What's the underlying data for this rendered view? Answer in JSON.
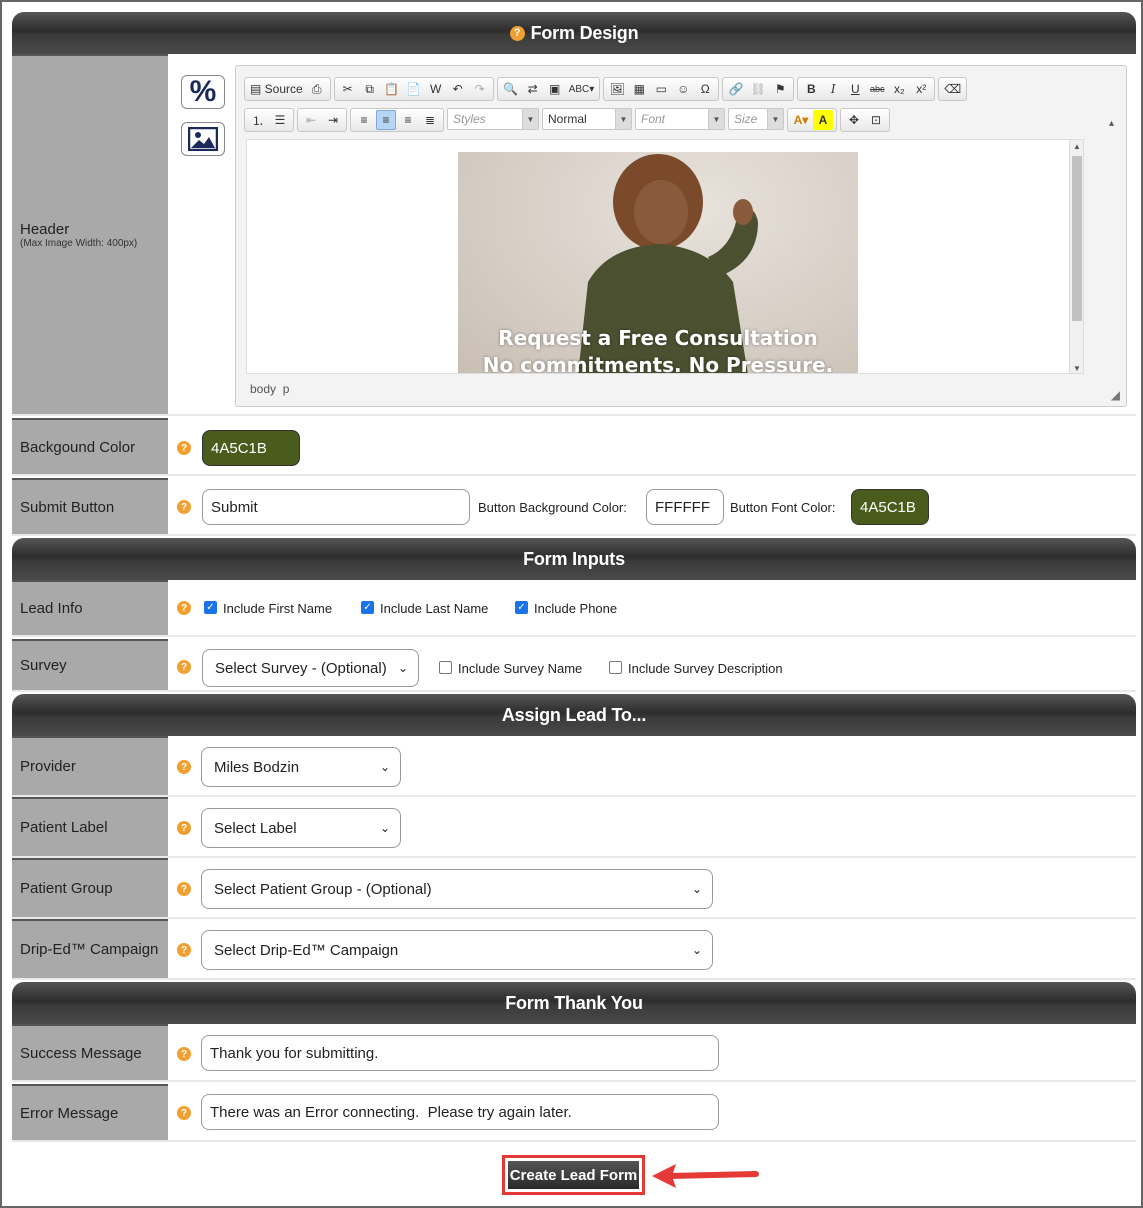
{
  "sections": {
    "form_design": "Form Design",
    "form_inputs": "Form Inputs",
    "assign_lead": "Assign Lead To...",
    "form_thank_you": "Form Thank You"
  },
  "header_row": {
    "label": "Header",
    "sublabel": "(Max Image Width: 400px)",
    "side_buttons": [
      "percent-icon",
      "image-icon"
    ]
  },
  "editor": {
    "source_label": "Source",
    "styles_placeholder": "Styles",
    "format_value": "Normal",
    "font_placeholder": "Font",
    "size_placeholder": "Size",
    "hero_line1": "Request a Free Consultation",
    "hero_line2": "No commitments. No Pressure.",
    "status_body": "body",
    "status_p": "p"
  },
  "background_color": {
    "label": "Backgound Color",
    "value": "4A5C1B",
    "color": "#4A5C1B"
  },
  "submit_button": {
    "label": "Submit Button",
    "text_value": "Submit",
    "bg_color_label": "Button Background Color:",
    "bg_color_value": "FFFFFF",
    "font_color_label": "Button Font Color:",
    "font_color_value": "4A5C1B"
  },
  "lead_info": {
    "label": "Lead Info",
    "options": [
      {
        "label": "Include First Name",
        "checked": true
      },
      {
        "label": "Include Last Name",
        "checked": true
      },
      {
        "label": "Include Phone",
        "checked": true
      }
    ]
  },
  "survey": {
    "label": "Survey",
    "select_value": "Select Survey - (Optional)",
    "options": [
      {
        "label": "Include Survey Name",
        "checked": false
      },
      {
        "label": "Include Survey Description",
        "checked": false
      }
    ]
  },
  "provider": {
    "label": "Provider",
    "value": "Miles Bodzin"
  },
  "patient_label": {
    "label": "Patient Label",
    "value": "Select Label"
  },
  "patient_group": {
    "label": "Patient Group",
    "value": "Select Patient Group - (Optional)"
  },
  "drip_campaign": {
    "label": "Drip-Ed™ Campaign",
    "value": "Select Drip-Ed™ Campaign"
  },
  "success_message": {
    "label": "Success Message",
    "value": "Thank you for submitting."
  },
  "error_message": {
    "label": "Error Message",
    "value": "There was an Error connecting.  Please try again later."
  },
  "create_button": "Create Lead Form",
  "accent_colors": {
    "help": "#f0a030",
    "highlight": "#e53935",
    "swatch": "#4A5C1B"
  }
}
